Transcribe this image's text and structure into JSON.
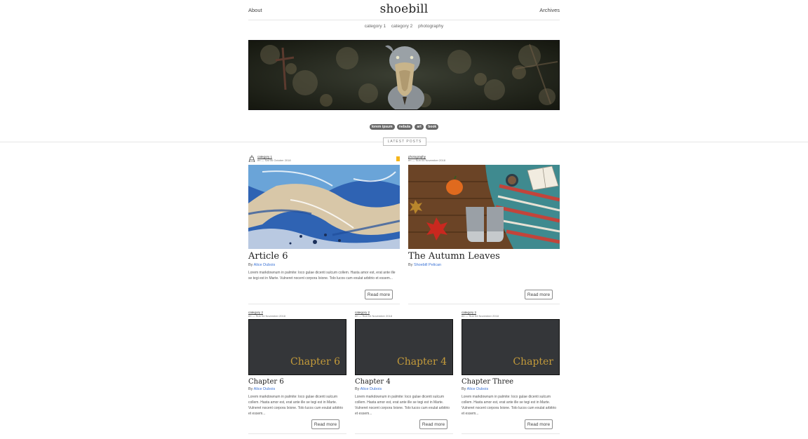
{
  "header": {
    "about": "About",
    "brand": "shoebill",
    "archives": "Archives"
  },
  "categories": [
    "category 1",
    "category 2",
    "photography"
  ],
  "tags": [
    "lorem ipsum",
    "nebula",
    "art",
    "book"
  ],
  "section_label": "LATEST POSTS",
  "featured": [
    {
      "category": "category 1",
      "meta": "en — Sat 06 October 2018",
      "title": "Article 6",
      "by": "By",
      "author": "Alice Dubois",
      "excerpt": "Lorem markdownum in palmite: loco gulae dicenti sulcum collem. Hasta amor est, erat ante ille se tegi est in Marte. Vulneret nocent corpora Ixione. Tolo lucos cum exulat arbitrio et essem...",
      "button": "Read more",
      "image": "marble-art"
    },
    {
      "category": "photography",
      "meta": "en — Sun 04 November 2018",
      "title": "The Autumn Leaves",
      "by": "By",
      "author": "Shoebill Pelican",
      "excerpt": "",
      "button": "Read more",
      "image": "autumn-flatlay"
    }
  ],
  "chapters": [
    {
      "category": "category 2",
      "meta": "en — Sun 04 November 2018",
      "cover": "Chapter 6",
      "title": "Chapter 6",
      "by": "By",
      "author": "Alice Dubois",
      "excerpt": "Lorem markdownum in palmite: loco gulae dicenti sulcum collem. Hasta amor est, erat ante ille se tegi est in Marte. Vulneret nocent corpora Ixione. Tolo lucos cum exulat arbitrio et essem...",
      "button": "Read more"
    },
    {
      "category": "category 2",
      "meta": "en — Sun 04 November 2018",
      "cover": "Chapter 4",
      "title": "Chapter 4",
      "by": "By",
      "author": "Alice Dubois",
      "excerpt": "Lorem markdownum in palmite: loco gulae dicenti sulcum collem. Hasta amor est, erat ante ille se tegi est in Marte. Vulneret nocent corpora Ixione. Tolo lucos cum exulat arbitrio et essem...",
      "button": "Read more"
    },
    {
      "category": "category 2",
      "meta": "en — Sun 04 November 2018",
      "cover": "Chapter",
      "title": "Chapter Three",
      "by": "By",
      "author": "Alice Dubois",
      "excerpt": "Lorem markdownum in palmite: loco gulae dicenti sulcum collem. Hasta amor est, erat ante ille se tegi est in Marte. Vulneret nocent corpora Ixione. Tolo lucos cum exulat arbitrio et essem...",
      "button": "Read more"
    }
  ],
  "colors": {
    "link": "#3b73d6",
    "chapter_text": "#c49b3a",
    "chapter_bg": "#343639",
    "flag": "#f5b51b"
  }
}
